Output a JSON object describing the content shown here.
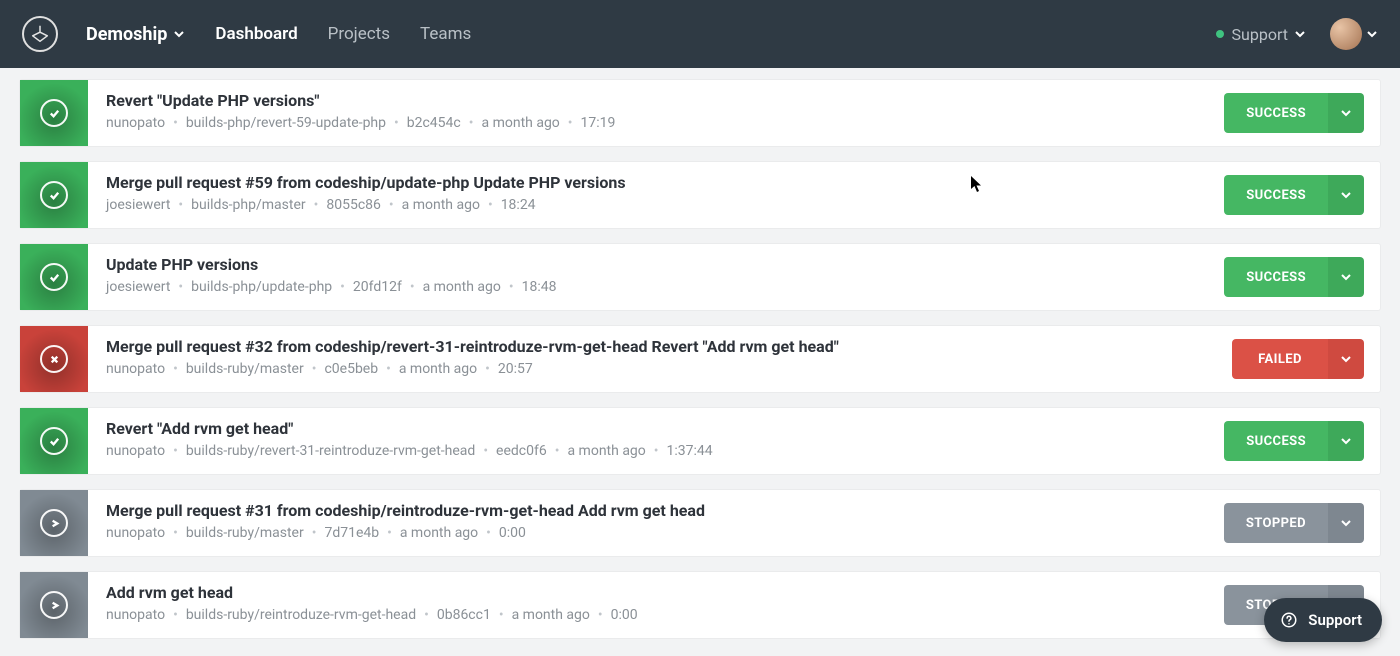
{
  "nav": {
    "org": "Demoship",
    "links": [
      "Dashboard",
      "Projects",
      "Teams"
    ],
    "active_index": 0,
    "support": "Support"
  },
  "builds": [
    {
      "title": "Revert \"Update PHP versions\"",
      "author": "nunopato",
      "branch": "builds-php/revert-59-update-php",
      "sha": "b2c454c",
      "time_rel": "a month ago",
      "duration": "17:19",
      "status": "SUCCESS"
    },
    {
      "title": "Merge pull request #59 from codeship/update-php Update PHP versions",
      "author": "joesiewert",
      "branch": "builds-php/master",
      "sha": "8055c86",
      "time_rel": "a month ago",
      "duration": "18:24",
      "status": "SUCCESS"
    },
    {
      "title": "Update PHP versions",
      "author": "joesiewert",
      "branch": "builds-php/update-php",
      "sha": "20fd12f",
      "time_rel": "a month ago",
      "duration": "18:48",
      "status": "SUCCESS"
    },
    {
      "title": "Merge pull request #32 from codeship/revert-31-reintroduze-rvm-get-head Revert \"Add rvm get head\"",
      "author": "nunopato",
      "branch": "builds-ruby/master",
      "sha": "c0e5beb",
      "time_rel": "a month ago",
      "duration": "20:57",
      "status": "FAILED"
    },
    {
      "title": "Revert \"Add rvm get head\"",
      "author": "nunopato",
      "branch": "builds-ruby/revert-31-reintroduze-rvm-get-head",
      "sha": "eedc0f6",
      "time_rel": "a month ago",
      "duration": "1:37:44",
      "status": "SUCCESS"
    },
    {
      "title": "Merge pull request #31 from codeship/reintroduze-rvm-get-head Add rvm get head",
      "author": "nunopato",
      "branch": "builds-ruby/master",
      "sha": "7d71e4b",
      "time_rel": "a month ago",
      "duration": "0:00",
      "status": "STOPPED"
    },
    {
      "title": "Add rvm get head",
      "author": "nunopato",
      "branch": "builds-ruby/reintroduze-rvm-get-head",
      "sha": "0b86cc1",
      "time_rel": "a month ago",
      "duration": "0:00",
      "status": "STOPPED"
    }
  ],
  "support_widget": {
    "label": "Support"
  },
  "colors": {
    "nav_bg": "#2f3a44",
    "success": "#45b763",
    "failed": "#db5146",
    "stopped": "#8a939c"
  }
}
